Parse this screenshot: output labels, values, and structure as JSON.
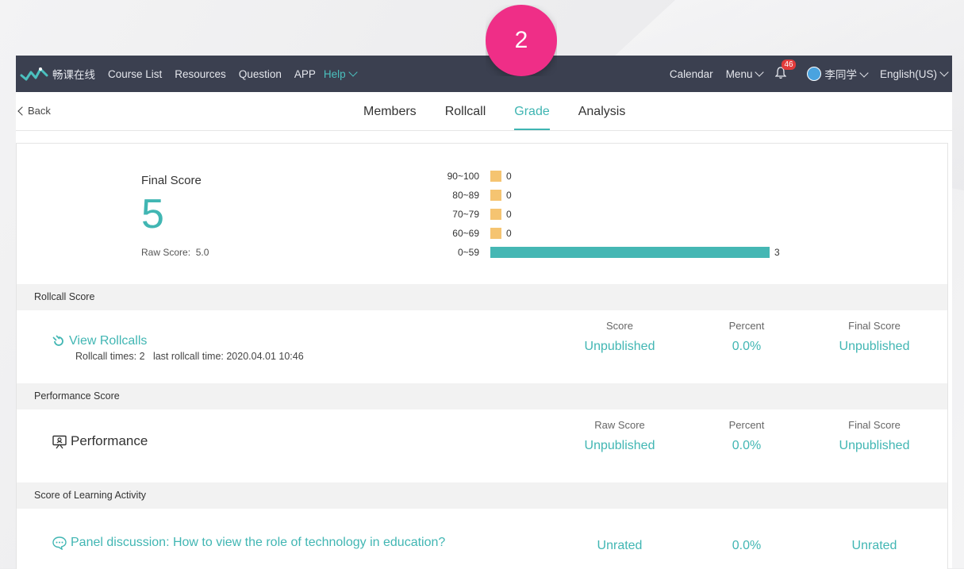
{
  "step_badge": "2",
  "topbar": {
    "site_name": "畅课在线",
    "links": [
      "Course List",
      "Resources",
      "Question",
      "APP"
    ],
    "help": "Help",
    "calendar": "Calendar",
    "menu": "Menu",
    "notification_count": "46",
    "user_name": "李同学",
    "language": "English(US)",
    "colors": {
      "bar": "#3b4050",
      "accent": "#4bc0be"
    }
  },
  "subnav": {
    "back": "Back",
    "tabs": [
      "Members",
      "Rollcall",
      "Grade",
      "Analysis"
    ],
    "active_tab": "Grade"
  },
  "final_score": {
    "title": "Final Score",
    "value": "5",
    "raw_label": "Raw Score:",
    "raw_value": "5.0"
  },
  "chart_data": {
    "type": "bar",
    "orientation": "horizontal",
    "categories": [
      "90~100",
      "80~89",
      "70~79",
      "60~69",
      "0~59"
    ],
    "values": [
      0,
      0,
      0,
      0,
      3
    ],
    "colors": {
      "zero": "#f5c471",
      "nonzero": "#45b7b4"
    }
  },
  "sections": {
    "rollcall": "Rollcall Score",
    "performance": "Performance Score",
    "learning": "Score of Learning Activity"
  },
  "rollcall_row": {
    "title": "View Rollcalls",
    "sub_times": "Rollcall times: 2",
    "sub_last": "last rollcall time: 2020.04.01 10:46",
    "headers": [
      "Score",
      "Percent",
      "Final Score"
    ],
    "values": [
      "Unpublished",
      "0.0%",
      "Unpublished"
    ]
  },
  "performance_row": {
    "title": "Performance",
    "headers": [
      "Raw Score",
      "Percent",
      "Final Score"
    ],
    "values": [
      "Unpublished",
      "0.0%",
      "Unpublished"
    ]
  },
  "activity_row": {
    "title": "Panel discussion: How to view the role of technology in education?",
    "values": [
      "Unrated",
      "0.0%",
      "Unrated"
    ]
  }
}
